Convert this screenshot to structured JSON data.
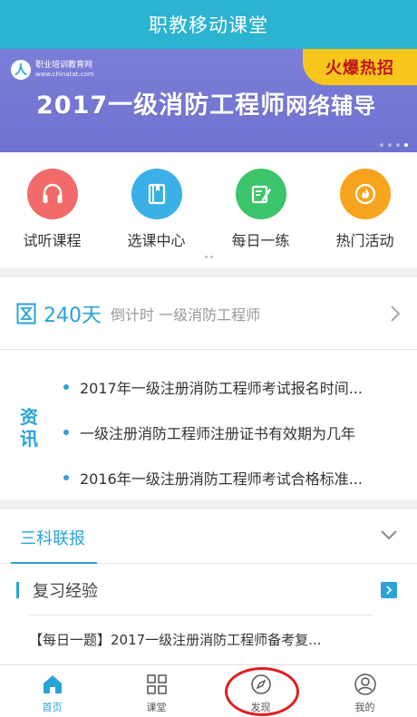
{
  "header": {
    "title": "职教移动课堂"
  },
  "banner": {
    "logo_name": "职业培训教育网",
    "logo_url": "www.chinatat.com",
    "tag": "火爆热招",
    "headline_main": "2017一级消防工程师",
    "headline_tail": "网络辅导"
  },
  "quick_links": [
    {
      "label": "试听课程",
      "icon": "headphones-icon",
      "color": "#f26a6a"
    },
    {
      "label": "选课中心",
      "icon": "book-icon",
      "color": "#3ab0e6"
    },
    {
      "label": "每日一练",
      "icon": "edit-icon",
      "color": "#3cc46a"
    },
    {
      "label": "热门活动",
      "icon": "flame-icon",
      "color": "#f7a31e"
    }
  ],
  "countdown": {
    "days": "240天",
    "text": "倒计时 一级消防工程师"
  },
  "news": {
    "badge": "资讯",
    "items": [
      "2017年一级注册消防工程师考试报名时间...",
      "一级注册消防工程师注册证书有效期为几年",
      "2016年一级注册消防工程师考试合格标准..."
    ]
  },
  "sections": {
    "active_tab": "三科联报",
    "review_title": "复习经验",
    "article": "【每日一题】2017一级注册消防工程师备考复..."
  },
  "tabbar": [
    {
      "label": "首页",
      "icon": "home-icon",
      "active": true
    },
    {
      "label": "课堂",
      "icon": "grid-icon",
      "active": false
    },
    {
      "label": "发现",
      "icon": "compass-icon",
      "active": false
    },
    {
      "label": "我的",
      "icon": "user-icon",
      "active": false
    }
  ],
  "colors": {
    "accent": "#2aa3d6",
    "header": "#2bb3cf",
    "highlight": "#e21d1d"
  }
}
